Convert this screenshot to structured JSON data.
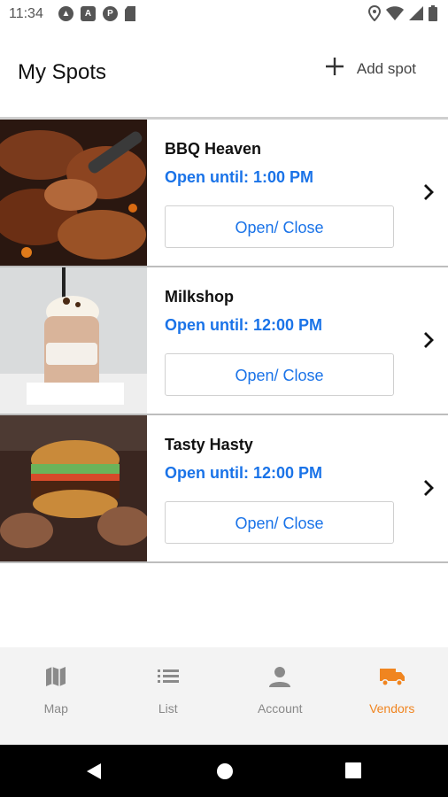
{
  "status_bar": {
    "time": "11:34"
  },
  "header": {
    "title": "My Spots",
    "add_label": "Add spot"
  },
  "spots": [
    {
      "name": "BBQ Heaven",
      "hours_prefix": "Open until:",
      "hours_time": "1:00 PM",
      "button_label": "Open/ Close"
    },
    {
      "name": "Milkshop",
      "hours_prefix": "Open until:",
      "hours_time": "12:00 PM",
      "button_label": "Open/ Close"
    },
    {
      "name": "Tasty Hasty",
      "hours_prefix": "Open until:",
      "hours_time": "12:00 PM",
      "button_label": "Open/ Close"
    }
  ],
  "bottom_nav": [
    {
      "label": "Map",
      "icon": "map-icon"
    },
    {
      "label": "List",
      "icon": "list-icon"
    },
    {
      "label": "Account",
      "icon": "person-icon"
    },
    {
      "label": "Vendors",
      "icon": "truck-icon",
      "active": true
    }
  ],
  "colors": {
    "accent_blue": "#1a73e8",
    "active_orange": "#f08520"
  }
}
